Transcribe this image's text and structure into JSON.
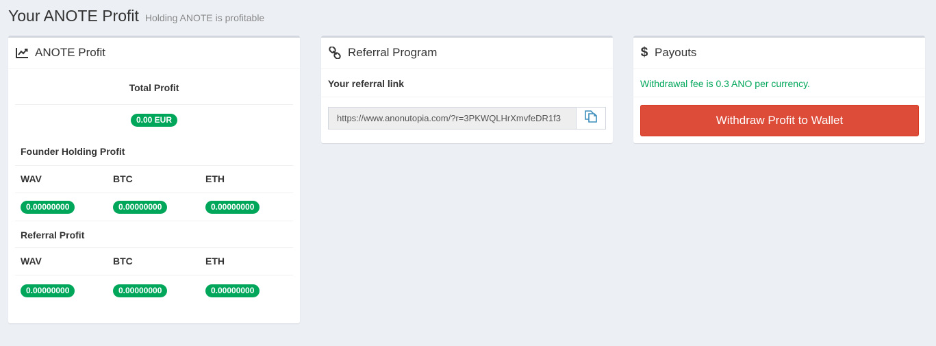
{
  "header": {
    "title": "Your ANOTE Profit",
    "subtitle": "Holding ANOTE is profitable"
  },
  "profit_box": {
    "title": "ANOTE Profit",
    "icon": "line-chart-icon",
    "total_profit_label": "Total Profit",
    "total_profit_value": "0.00 EUR",
    "founder_label": "Founder Holding Profit",
    "founder": {
      "columns": [
        "WAV",
        "BTC",
        "ETH"
      ],
      "values": [
        "0.00000000",
        "0.00000000",
        "0.00000000"
      ]
    },
    "referral_label": "Referral Profit",
    "referral": {
      "columns": [
        "WAV",
        "BTC",
        "ETH"
      ],
      "values": [
        "0.00000000",
        "0.00000000",
        "0.00000000"
      ]
    }
  },
  "referral_box": {
    "title": "Referral Program",
    "icon": "link-icon",
    "link_label": "Your referral link",
    "link_value": "https://www.anonutopia.com/?r=3PKWQLHrXmvfeDR1f3",
    "copy_icon": "copy-icon"
  },
  "payouts_box": {
    "title": "Payouts",
    "icon": "dollar-icon",
    "fee_text": "Withdrawal fee is 0.3 ANO per currency.",
    "withdraw_label": "Withdraw Profit to Wallet"
  },
  "colors": {
    "background": "#ecf0f5",
    "success": "#00a65a",
    "danger": "#dd4b39",
    "copy_icon": "#3c8dbc"
  }
}
